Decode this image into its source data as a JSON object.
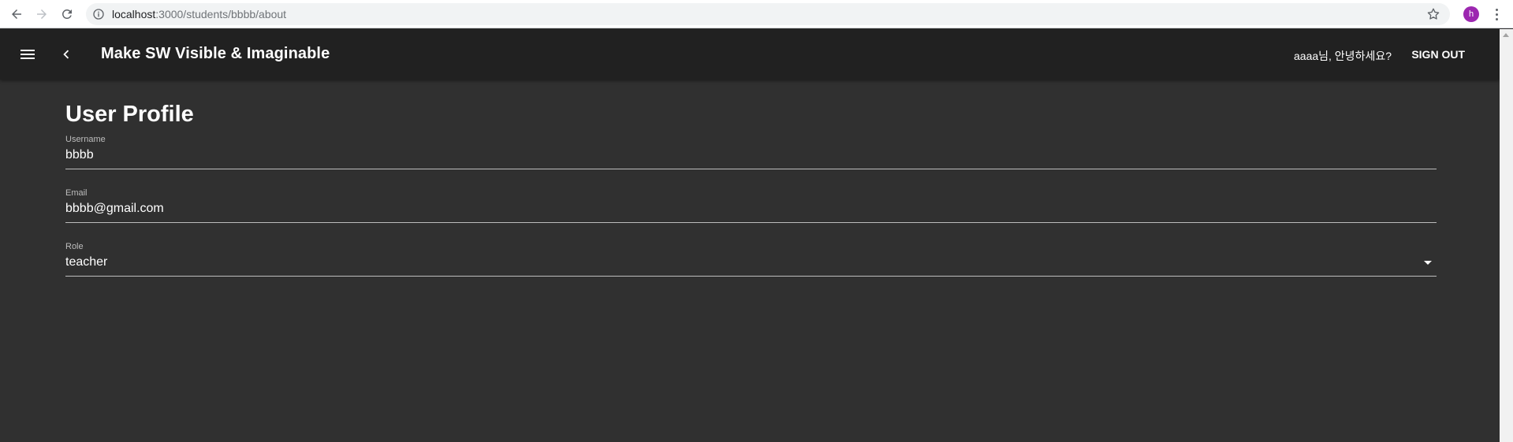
{
  "browser": {
    "url_host": "localhost",
    "url_path": ":3000/students/bbbb/about",
    "profile_initial": "h"
  },
  "appbar": {
    "title": "Make SW Visible & Imaginable",
    "greeting": "aaaa님, 안녕하세요?",
    "signout_label": "SIGN OUT"
  },
  "profile": {
    "heading": "User Profile",
    "fields": [
      {
        "label": "Username",
        "value": "bbbb"
      },
      {
        "label": "Email",
        "value": "bbbb@gmail.com"
      },
      {
        "label": "Role",
        "value": "teacher"
      }
    ]
  },
  "colors": {
    "background": "#303030",
    "appbar": "#212121",
    "avatar": "#9c27b0"
  }
}
